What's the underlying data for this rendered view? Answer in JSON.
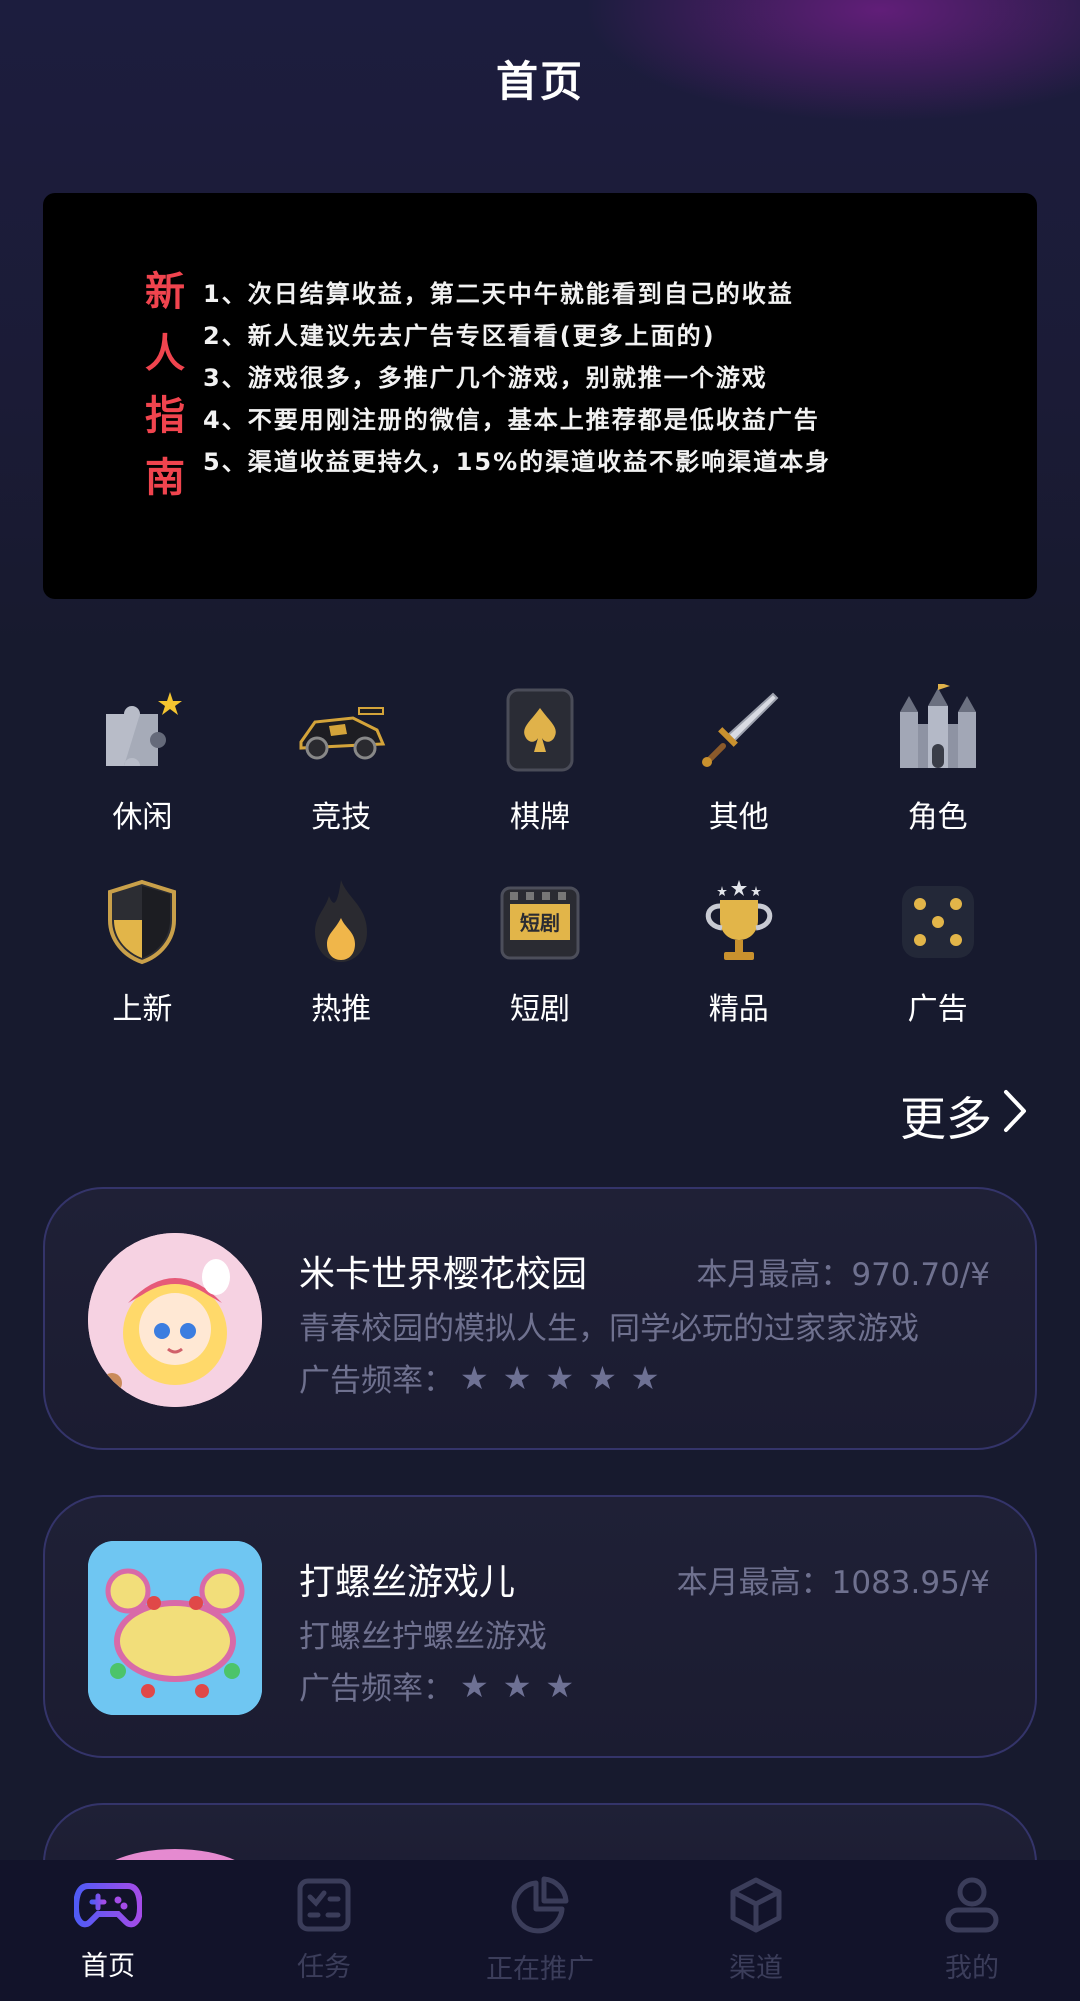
{
  "header": {
    "title": "首页"
  },
  "guide": {
    "title": "新人指南",
    "items": [
      "1、次日结算收益，第二天中午就能看到自己的收益",
      "2、新人建议先去广告专区看看(更多上面的)",
      "3、游戏很多，多推广几个游戏，别就推一个游戏",
      "4、不要用刚注册的微信，基本上推荐都是低收益广告",
      "5、渠道收益更持久，15%的渠道收益不影响渠道本身"
    ]
  },
  "categories": [
    {
      "label": "休闲",
      "icon": "puzzle-icon"
    },
    {
      "label": "竞技",
      "icon": "race-car-icon"
    },
    {
      "label": "棋牌",
      "icon": "spade-card-icon"
    },
    {
      "label": "其他",
      "icon": "sword-icon"
    },
    {
      "label": "角色",
      "icon": "castle-icon"
    },
    {
      "label": "上新",
      "icon": "shield-icon"
    },
    {
      "label": "热推",
      "icon": "flame-icon"
    },
    {
      "label": "短剧",
      "icon": "clapper-icon"
    },
    {
      "label": "精品",
      "icon": "trophy-icon"
    },
    {
      "label": "广告",
      "icon": "dice-icon"
    }
  ],
  "more_label": "更多",
  "games": [
    {
      "name": "米卡世界樱花校园",
      "max": "本月最高：970.70/¥",
      "desc": "青春校园的模拟人生，同学必玩的过家家游戏",
      "freq_label": "广告频率：",
      "stars": 5
    },
    {
      "name": "打螺丝游戏儿",
      "max": "本月最高：1083.95/¥",
      "desc": "打螺丝拧螺丝游戏",
      "freq_label": "广告频率：",
      "stars": 3
    }
  ],
  "tabs": [
    {
      "label": "首页",
      "icon": "gamepad-icon",
      "active": true
    },
    {
      "label": "任务",
      "icon": "task-icon",
      "active": false
    },
    {
      "label": "正在推广",
      "icon": "pie-chart-icon",
      "active": false
    },
    {
      "label": "渠道",
      "icon": "cube-icon",
      "active": false
    },
    {
      "label": "我的",
      "icon": "user-icon",
      "active": false
    }
  ],
  "colors": {
    "background": "#171a2e",
    "accent": "#6a4cf5",
    "guide_title": "#f0444e",
    "muted_text": "#6f718f"
  }
}
